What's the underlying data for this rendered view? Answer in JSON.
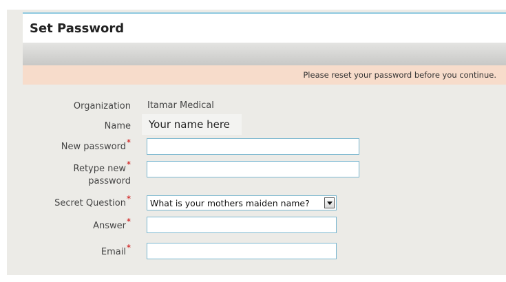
{
  "page": {
    "title": "Set Password",
    "notice": "Please reset your password before you continue."
  },
  "form": {
    "organization_label": "Organization",
    "organization_value": "Itamar Medical",
    "name_label": "Name",
    "name_value": "Your name here",
    "new_password_label": "New password",
    "retype_label_1": "Retype new",
    "retype_label_2": "password",
    "secret_question_label": "Secret Question",
    "secret_question_value": "What is your mothers maiden name?",
    "answer_label": "Answer",
    "email_label": "Email",
    "required_mark": "*",
    "new_password_value": "",
    "retype_value": "",
    "answer_value": "",
    "email_value": ""
  },
  "colors": {
    "notice_bg": "#f7dccb",
    "field_border": "#78b6cf",
    "required": "#cc0000"
  }
}
